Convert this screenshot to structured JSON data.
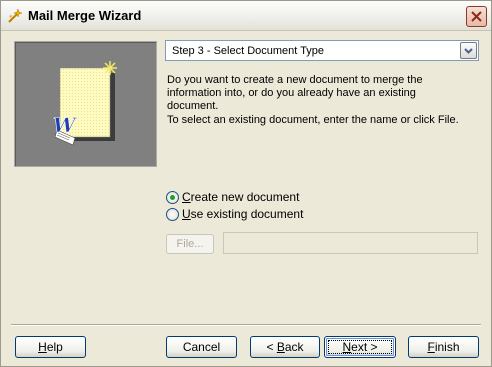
{
  "window": {
    "title": "Mail Merge Wizard",
    "icon": "mail-merge-wand-icon",
    "close_icon": "close-icon"
  },
  "step_select": {
    "value": "Step 3 - Select Document Type",
    "arrow_icon": "chevron-down-icon"
  },
  "description": {
    "line1": "Do you want to create a new document to merge the information into, or do you already have an existing document.",
    "line2": "To select an existing document, enter the name or click File."
  },
  "options": {
    "create_new": {
      "access_key": "C",
      "rest": "reate new document",
      "selected": true
    },
    "use_existing": {
      "access_key": "U",
      "rest": "se existing document",
      "selected": false
    }
  },
  "file": {
    "button_label": "File...",
    "input_value": ""
  },
  "buttons": {
    "help": {
      "access_key": "H",
      "rest": "elp"
    },
    "cancel": "Cancel",
    "back": {
      "prefix": "< ",
      "access_key": "B",
      "rest": "ack"
    },
    "next": {
      "access_key": "N",
      "rest": "ext >"
    },
    "finish": {
      "access_key": "F",
      "rest": "inish"
    }
  },
  "colors": {
    "dialog_bg": "#ece9d8",
    "illustration_bg": "#808080",
    "paper": "#fffbbf",
    "radio_dot": "#21a121",
    "button_border": "#003c74"
  }
}
